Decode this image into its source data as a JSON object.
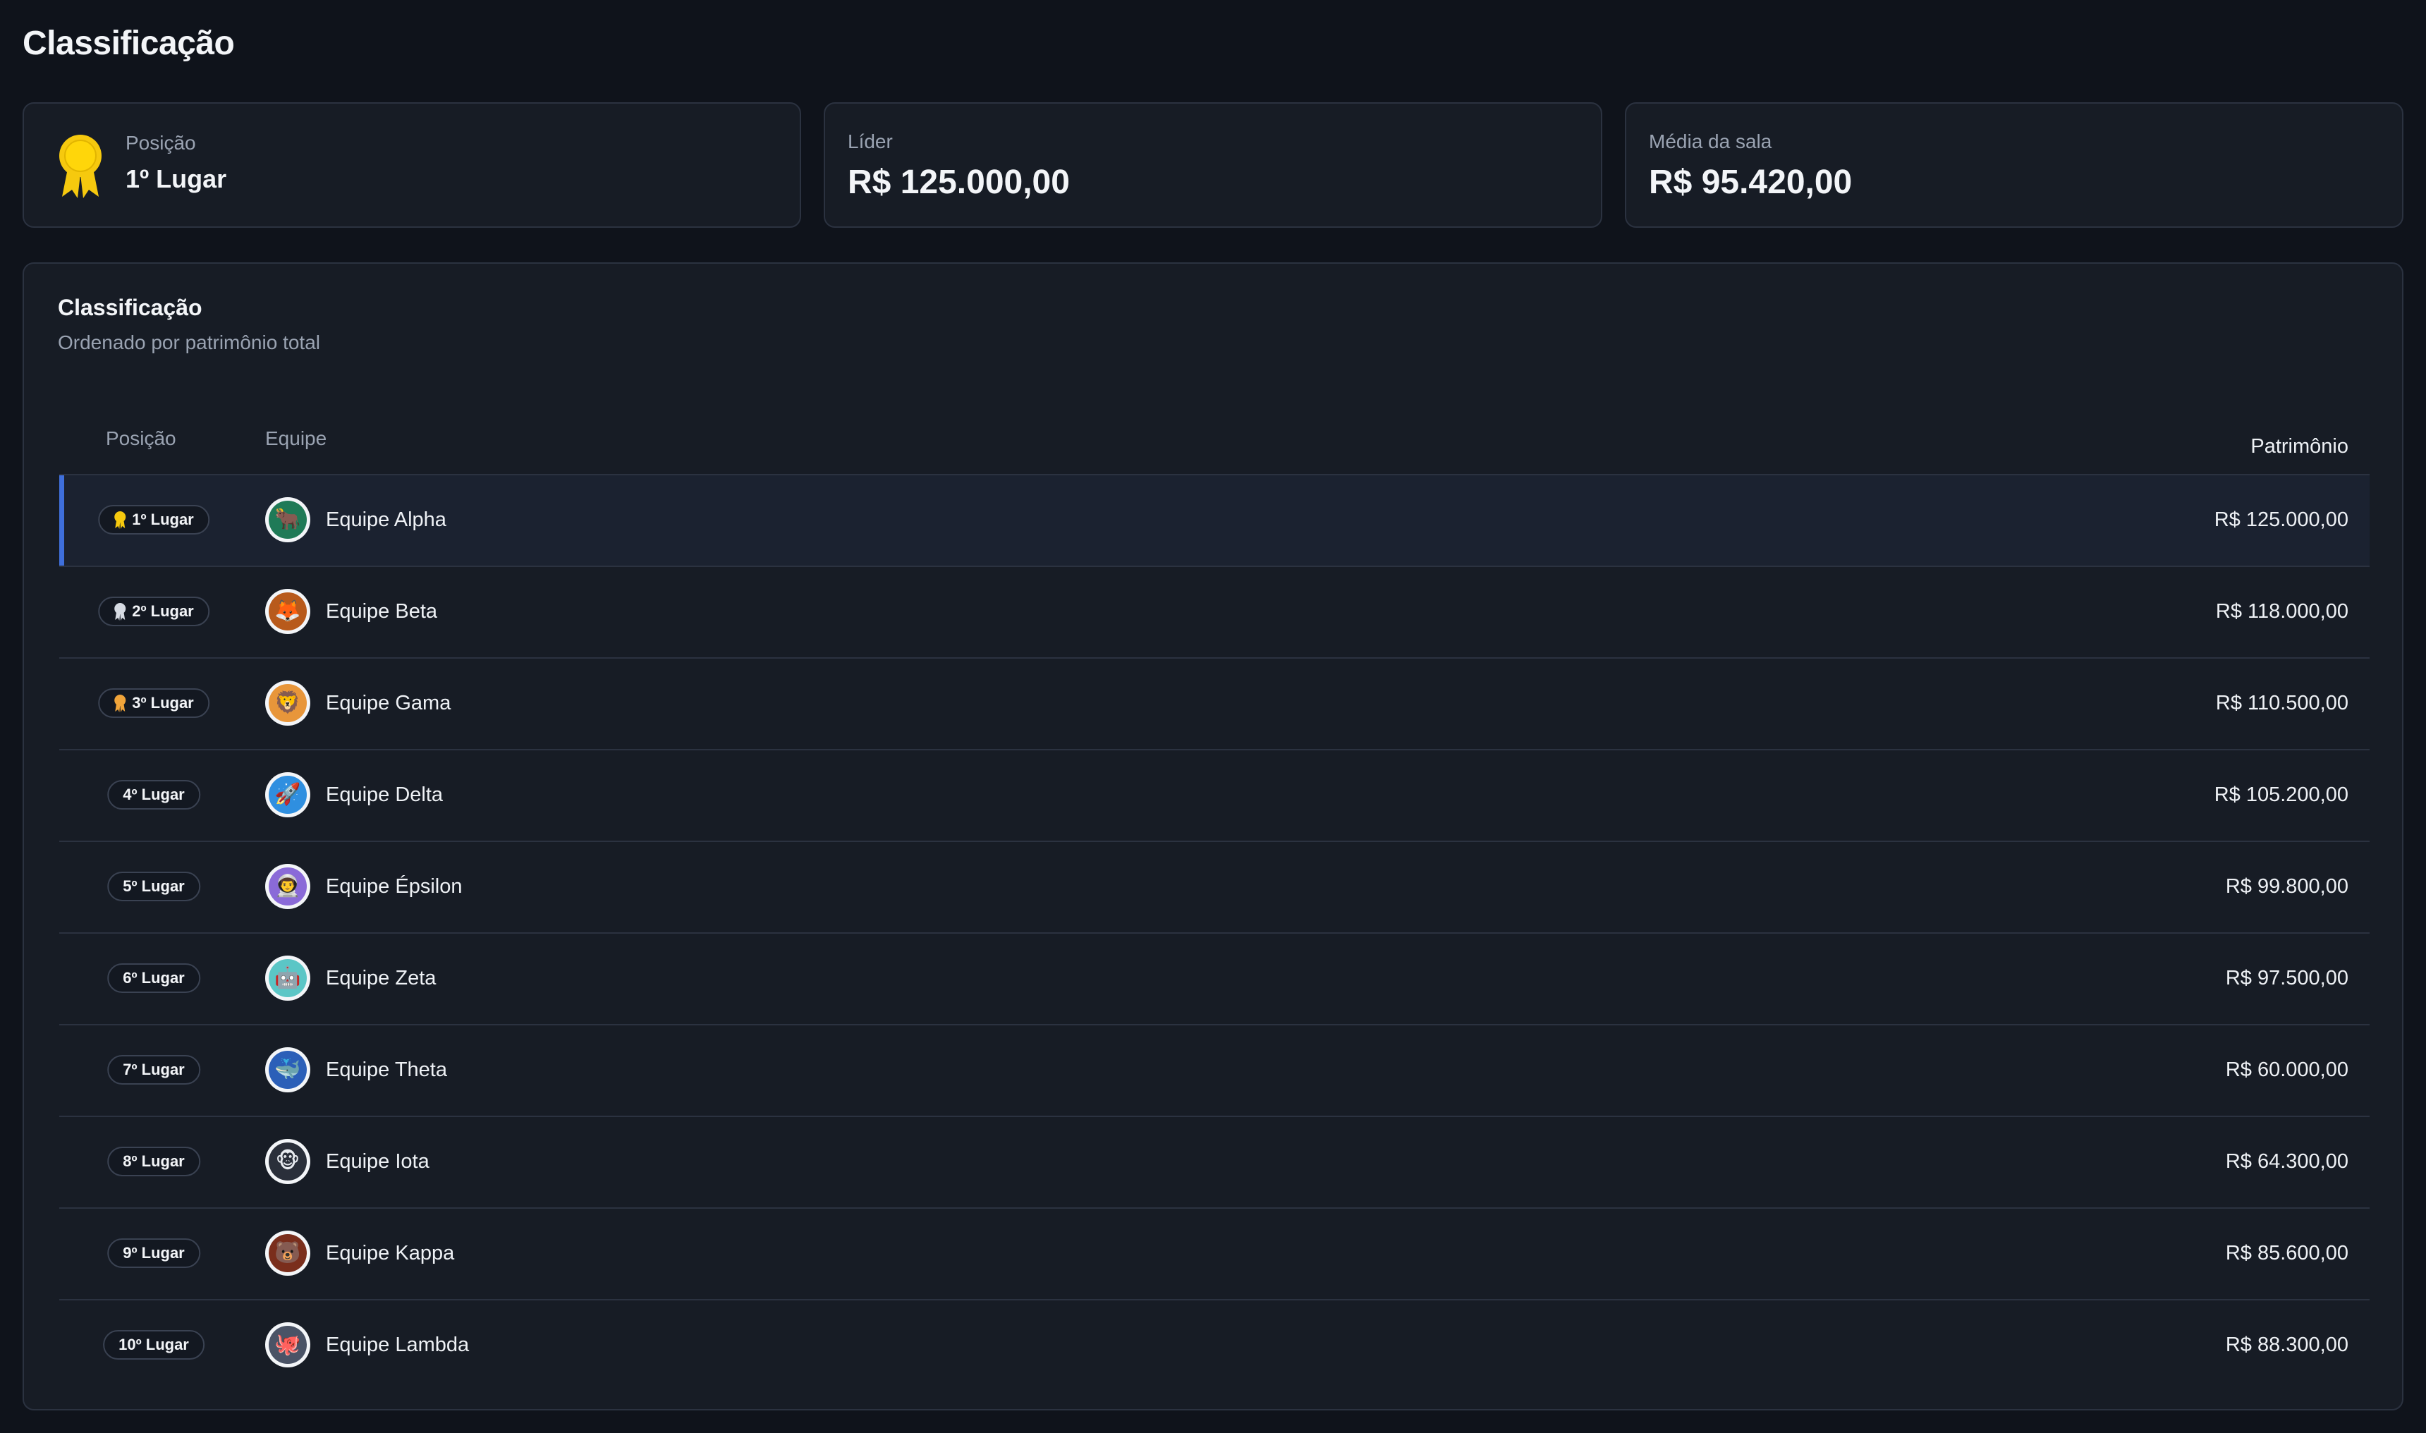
{
  "page": {
    "title": "Classificação"
  },
  "stats": {
    "position": {
      "label": "Posição",
      "value": "1º Lugar",
      "icon": "ribbon-gold-icon",
      "color": "#f6c90e"
    },
    "leader": {
      "label": "Líder",
      "value": "R$ 125.000,00"
    },
    "average": {
      "label": "Média da sala",
      "value": "R$ 95.420,00"
    }
  },
  "ranking": {
    "title": "Classificação",
    "subtitle": "Ordenado por patrimônio total",
    "columns": {
      "position": "Posição",
      "team": "Equipe",
      "worth": "Patrimônio"
    },
    "rows": [
      {
        "rank": "1º Lugar",
        "team": "Equipe Alpha",
        "worth": "R$ 125.000,00",
        "medal": "gold",
        "avatar": "bull",
        "avatar_color": "#1f7a57",
        "avatar_glyph": "🐂"
      },
      {
        "rank": "2º Lugar",
        "team": "Equipe Beta",
        "worth": "R$ 118.000,00",
        "medal": "silver",
        "avatar": "fox",
        "avatar_color": "#b85a1c",
        "avatar_glyph": "🦊"
      },
      {
        "rank": "3º Lugar",
        "team": "Equipe Gama",
        "worth": "R$ 110.500,00",
        "medal": "bronze",
        "avatar": "lion",
        "avatar_color": "#e8963a",
        "avatar_glyph": "🦁"
      },
      {
        "rank": "4º Lugar",
        "team": "Equipe Delta",
        "worth": "R$ 105.200,00",
        "medal": "none",
        "avatar": "rocket",
        "avatar_color": "#2f8fe0",
        "avatar_glyph": "🚀"
      },
      {
        "rank": "5º Lugar",
        "team": "Equipe Épsilon",
        "worth": "R$ 99.800,00",
        "medal": "none",
        "avatar": "astronaut",
        "avatar_color": "#8a6ad8",
        "avatar_glyph": "👨‍🚀"
      },
      {
        "rank": "6º Lugar",
        "team": "Equipe Zeta",
        "worth": "R$ 97.500,00",
        "medal": "none",
        "avatar": "robot",
        "avatar_color": "#5bc6c6",
        "avatar_glyph": "🤖"
      },
      {
        "rank": "7º Lugar",
        "team": "Equipe Theta",
        "worth": "R$ 60.000,00",
        "medal": "none",
        "avatar": "whale",
        "avatar_color": "#2b5fb8",
        "avatar_glyph": "🐳"
      },
      {
        "rank": "8º Lugar",
        "team": "Equipe Iota",
        "worth": "R$ 64.300,00",
        "medal": "none",
        "avatar": "monkey",
        "avatar_color": "#2a2f3a",
        "avatar_glyph": "🐵"
      },
      {
        "rank": "9º Lugar",
        "team": "Equipe Kappa",
        "worth": "R$ 85.600,00",
        "medal": "none",
        "avatar": "bear",
        "avatar_color": "#7a2e1c",
        "avatar_glyph": "🐻"
      },
      {
        "rank": "10º Lugar",
        "team": "Equipe Lambda",
        "worth": "R$ 88.300,00",
        "medal": "none",
        "avatar": "octopus",
        "avatar_color": "#4a5366",
        "avatar_glyph": "🐙"
      }
    ]
  },
  "colors": {
    "gold": "#f6c90e",
    "silver": "#d6dbe3",
    "bronze": "#f0a43a",
    "accent": "#3f6fdb"
  }
}
